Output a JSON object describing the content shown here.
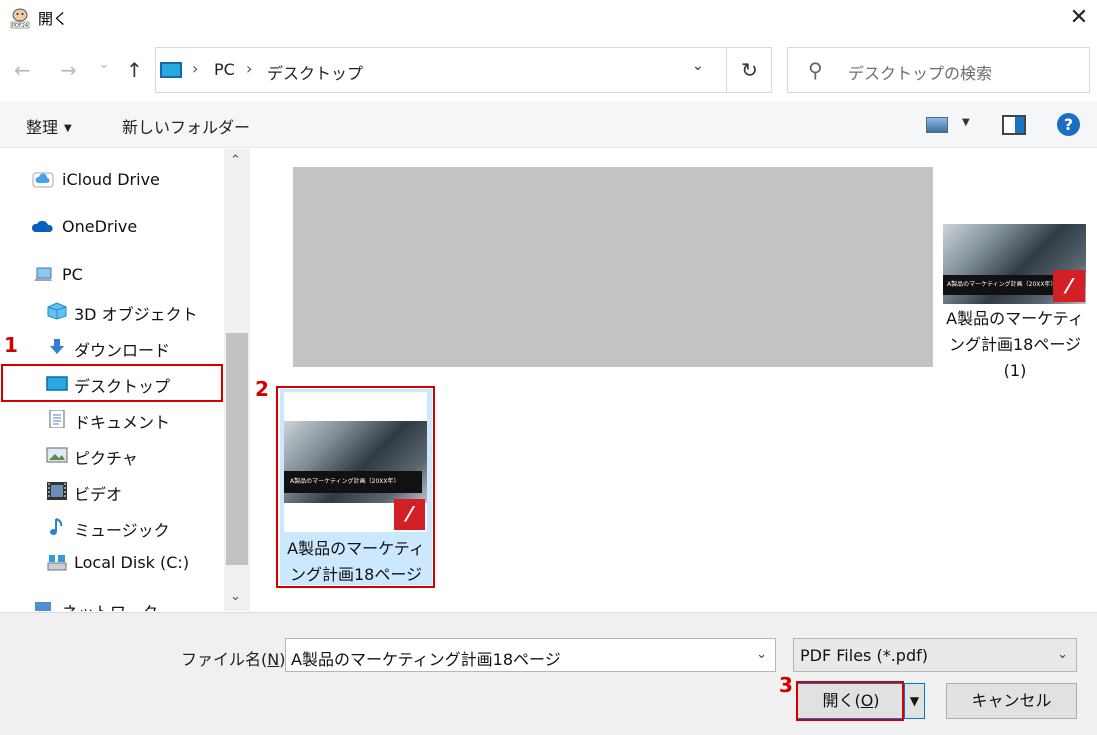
{
  "window": {
    "title": "開く",
    "close_glyph": "✕"
  },
  "nav": {
    "back_glyph": "←",
    "forward_glyph": "→",
    "recent_glyph": "⌄",
    "up_glyph": "↑",
    "address": [
      "PC",
      "デスクトップ"
    ],
    "separator": "›",
    "dropdown_glyph": "⌄",
    "refresh_glyph": "↻",
    "search_placeholder": "デスクトップの検索",
    "search_glyph": "⚲"
  },
  "toolbar": {
    "organize": "整理",
    "organize_caret": "▼",
    "new_folder": "新しいフォルダー",
    "view_caret": "▼",
    "help_glyph": "?"
  },
  "sidebar": {
    "items": [
      {
        "label": "iCloud Drive",
        "icon": "icloud-icon"
      },
      {
        "label": "OneDrive",
        "icon": "onedrive-icon"
      },
      {
        "label": "PC",
        "icon": "pc-icon"
      },
      {
        "label": "3D オブジェクト",
        "icon": "3d-objects-icon"
      },
      {
        "label": "ダウンロード",
        "icon": "download-icon"
      },
      {
        "label": "デスクトップ",
        "icon": "desktop-icon"
      },
      {
        "label": "ドキュメント",
        "icon": "documents-icon"
      },
      {
        "label": "ピクチャ",
        "icon": "pictures-icon"
      },
      {
        "label": "ビデオ",
        "icon": "videos-icon"
      },
      {
        "label": "ミュージック",
        "icon": "music-icon"
      },
      {
        "label": "Local Disk (C:)",
        "icon": "local-disk-icon"
      },
      {
        "label": "ネットワーク",
        "icon": "network-icon"
      }
    ],
    "scroll_up": "⌃",
    "scroll_down": "⌄"
  },
  "files": [
    {
      "name": "A製品のマーケティング計画18ページ (1)",
      "line1": "A製品のマーケティ",
      "line2": "ング計画18ページ",
      "line3": "(1)",
      "banner": "A製品のマーケティング計画（20XX年）"
    },
    {
      "name": "A製品のマーケティング計画18ページ",
      "line1": "A製品のマーケティ",
      "line2": "ング計画18ページ",
      "banner": "A製品のマーケティング計画（20XX年）"
    }
  ],
  "annotations": {
    "step1": "1",
    "step2": "2",
    "step3": "3",
    "color": "#d40000"
  },
  "footer": {
    "filename_label": "ファイル名(N):",
    "filename_value": "A製品のマーケティング計画18ページ",
    "filter_value": "PDF Files (*.pdf)",
    "open_label": "開く(O)",
    "split_caret": "▼",
    "cancel_label": "キャンセル",
    "drop_glyph": "⌄"
  },
  "colors": {
    "accent": "#0078d7",
    "selection": "#cce8ff",
    "pdf_red": "#d31f26"
  }
}
